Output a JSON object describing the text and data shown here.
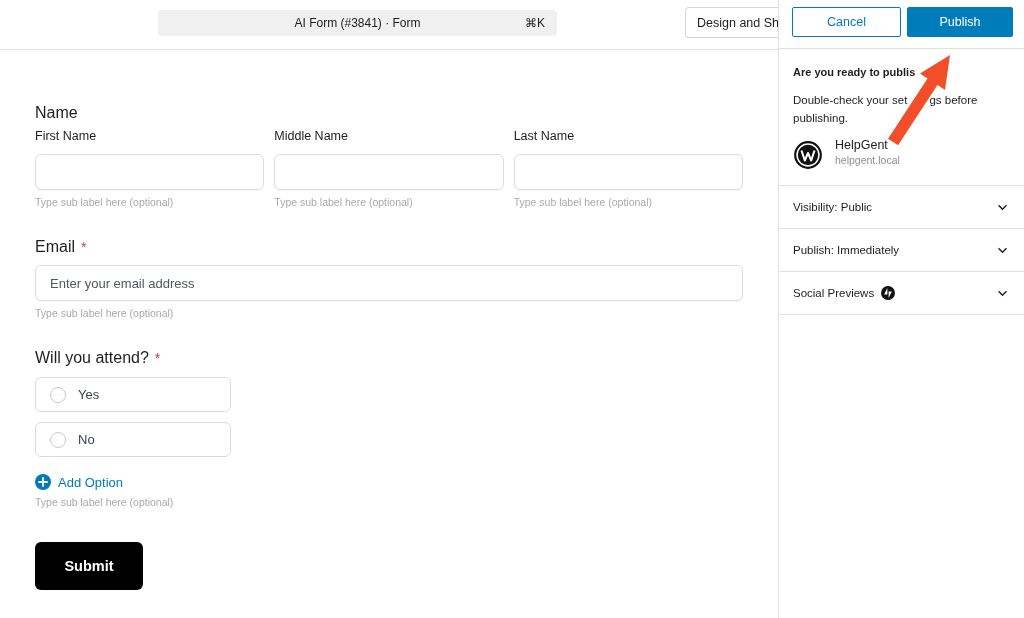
{
  "header": {
    "command_bar": {
      "title": "AI Form (#3841) · Form",
      "shortcut": "⌘K"
    },
    "design_button": "Design and Sh"
  },
  "form": {
    "fields": [
      {
        "kind": "name",
        "label": "Name",
        "parts": [
          {
            "label": "First Name",
            "hint": "Type sub label here (optional)"
          },
          {
            "label": "Middle Name",
            "hint": "Type sub label here (optional)"
          },
          {
            "label": "Last Name",
            "hint": "Type sub label here (optional)"
          }
        ]
      },
      {
        "kind": "email",
        "label": "Email",
        "required_mark": "*",
        "placeholder": "Enter your email address",
        "hint": "Type sub label here (optional)"
      },
      {
        "kind": "radio",
        "label": "Will you attend?",
        "required_mark": "*",
        "options": [
          {
            "label": "Yes",
            "selected": false
          },
          {
            "label": "No",
            "selected": false
          }
        ],
        "add_option": "Add Option",
        "hint": "Type sub label here (optional)"
      }
    ],
    "submit": "Submit"
  },
  "publish_panel": {
    "buttons": [
      {
        "label": "Cancel",
        "kind": "secondary"
      },
      {
        "label": "Publish",
        "kind": "primary"
      }
    ],
    "heading": "Are you ready to publis",
    "description_parts": [
      "Double-check your set",
      "gs before",
      "publishing."
    ],
    "site": {
      "name": "HelpGent",
      "url": "helpgent.local"
    },
    "sections": [
      {
        "label": "Visibility: Public",
        "kind": "plain",
        "expanded": false
      },
      {
        "label": "Publish: Immediately",
        "kind": "plain",
        "expanded": false
      },
      {
        "label": "Social Previews",
        "kind": "badged",
        "expanded": false
      }
    ]
  }
}
